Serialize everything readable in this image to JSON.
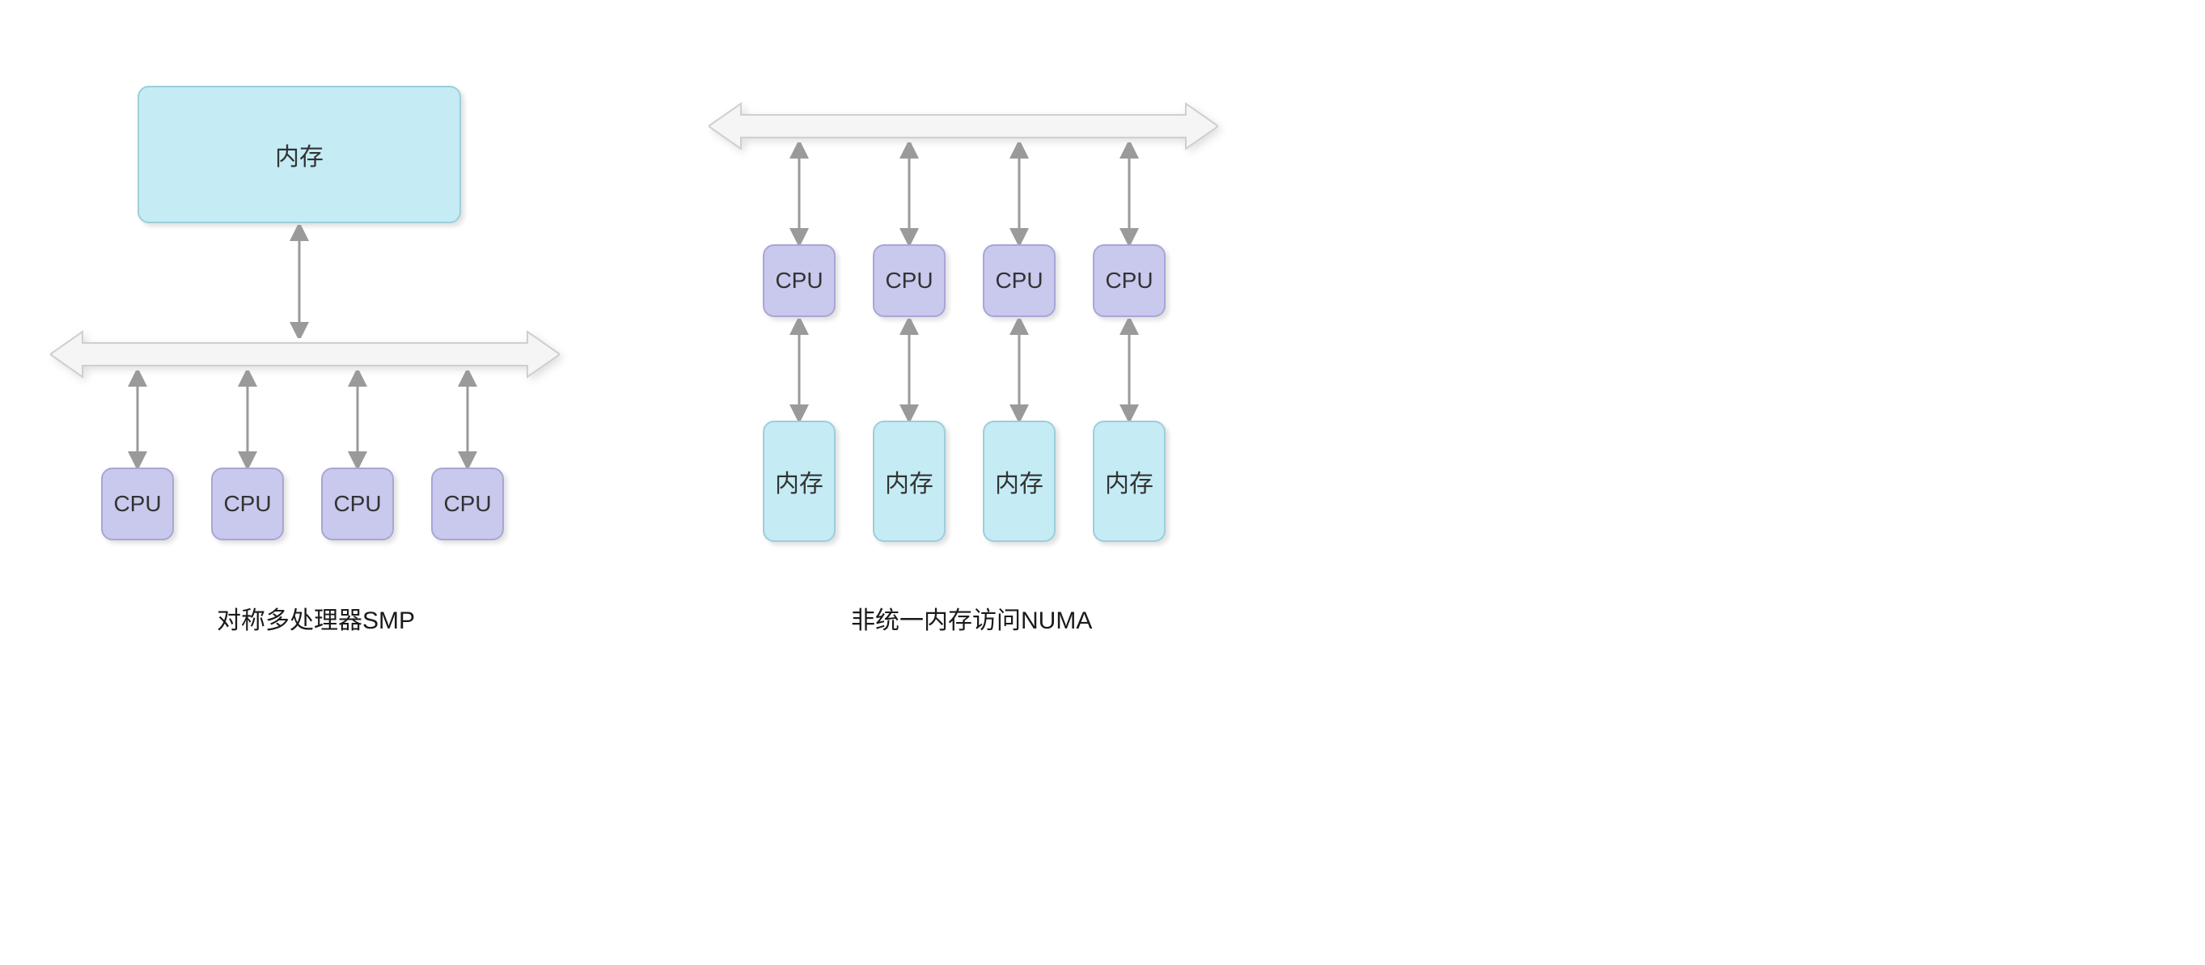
{
  "smp": {
    "memory_label": "内存",
    "cpu_labels": [
      "CPU",
      "CPU",
      "CPU",
      "CPU"
    ],
    "caption": "对称多处理器SMP"
  },
  "numa": {
    "cpu_labels": [
      "CPU",
      "CPU",
      "CPU",
      "CPU"
    ],
    "memory_labels": [
      "内存",
      "内存",
      "内存",
      "内存"
    ],
    "caption": "非统一内存访问NUMA"
  },
  "chart_data": {
    "type": "diagram",
    "diagrams": [
      {
        "name": "SMP",
        "caption": "对称多处理器SMP",
        "topology": "shared-memory-bus",
        "memory_nodes": [
          {
            "label": "内存"
          }
        ],
        "cpu_nodes": [
          {
            "label": "CPU"
          },
          {
            "label": "CPU"
          },
          {
            "label": "CPU"
          },
          {
            "label": "CPU"
          }
        ],
        "connections": [
          {
            "from": "内存",
            "to": "bus",
            "bidirectional": true
          },
          {
            "from": "CPU[0]",
            "to": "bus",
            "bidirectional": true
          },
          {
            "from": "CPU[1]",
            "to": "bus",
            "bidirectional": true
          },
          {
            "from": "CPU[2]",
            "to": "bus",
            "bidirectional": true
          },
          {
            "from": "CPU[3]",
            "to": "bus",
            "bidirectional": true
          }
        ]
      },
      {
        "name": "NUMA",
        "caption": "非统一内存访问NUMA",
        "topology": "per-cpu-local-memory-bus",
        "cpu_nodes": [
          {
            "label": "CPU"
          },
          {
            "label": "CPU"
          },
          {
            "label": "CPU"
          },
          {
            "label": "CPU"
          }
        ],
        "memory_nodes": [
          {
            "label": "内存"
          },
          {
            "label": "内存"
          },
          {
            "label": "内存"
          },
          {
            "label": "内存"
          }
        ],
        "connections": [
          {
            "from": "bus",
            "to": "CPU[0]",
            "bidirectional": true
          },
          {
            "from": "bus",
            "to": "CPU[1]",
            "bidirectional": true
          },
          {
            "from": "bus",
            "to": "CPU[2]",
            "bidirectional": true
          },
          {
            "from": "bus",
            "to": "CPU[3]",
            "bidirectional": true
          },
          {
            "from": "CPU[0]",
            "to": "内存[0]",
            "bidirectional": true
          },
          {
            "from": "CPU[1]",
            "to": "内存[1]",
            "bidirectional": true
          },
          {
            "from": "CPU[2]",
            "to": "内存[2]",
            "bidirectional": true
          },
          {
            "from": "CPU[3]",
            "to": "内存[3]",
            "bidirectional": true
          }
        ]
      }
    ]
  }
}
